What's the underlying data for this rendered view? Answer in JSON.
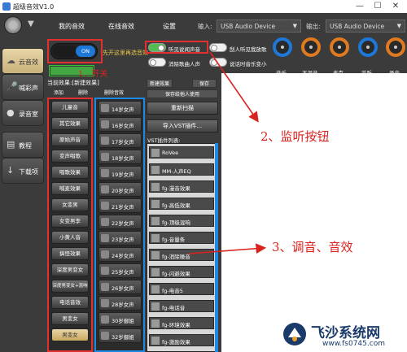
{
  "window": {
    "title": "超级音效V1.0",
    "min": "—",
    "max": "☐",
    "close": "✕"
  },
  "menu": {
    "tabs": [
      "我的音效",
      "在线音效",
      "设置"
    ]
  },
  "devices": {
    "input_label": "输入:",
    "input_value": "USB Audio Device",
    "output_label": "输出:",
    "output_value": "USB Audio Device"
  },
  "sidebar": {
    "items": [
      {
        "label": "云音效",
        "icon": "cloud-icon",
        "active": true
      },
      {
        "label": "喊彩声",
        "icon": "mic-icon"
      },
      {
        "label": "录音室",
        "icon": "record-icon"
      },
      {
        "label": "教程",
        "icon": "book-icon"
      },
      {
        "label": "下载项",
        "icon": "download-icon"
      }
    ]
  },
  "power": {
    "state": "ON",
    "hint": "先开这里再选音效"
  },
  "toggles": {
    "monitor": "听见说闻声音",
    "denoise": "消除歌曲人声",
    "opt1": "刮人听见我放歌",
    "opt2": "说话时音乐变小"
  },
  "knobs": [
    {
      "label": "音乐",
      "color": "#1e78d8"
    },
    {
      "label": "不混音",
      "color": "#e07a20"
    },
    {
      "label": "麦克",
      "color": "#e07a20"
    },
    {
      "label": "监听",
      "color": "#1e78d8"
    },
    {
      "label": "录音",
      "color": "#e07a20"
    }
  ],
  "list": {
    "header": "当前效果:[新建效果]",
    "buttons": [
      "添加",
      "删除",
      "删除音效"
    ],
    "right_buttons": [
      "新建效果",
      "保存",
      "保存给他人使用"
    ]
  },
  "effects": [
    "儿童音",
    "其它效果",
    "原始声音",
    "变声唱歌",
    "唱歌效果",
    "喊麦效果",
    "女变男",
    "女变男李",
    "小黄人音",
    "搞怪效果",
    "深度男变女",
    "深度男变女+混响",
    "电话音效",
    "男变女",
    "男变女"
  ],
  "voices": [
    "14岁女声",
    "16岁女声",
    "17岁女声",
    "18岁女声",
    "19岁女声",
    "20岁女声",
    "21岁女声",
    "22岁女声",
    "23岁女声",
    "24岁女声",
    "25岁女声",
    "26岁女声",
    "28岁女声",
    "30岁御姐",
    "32岁御姐"
  ],
  "right_panel": {
    "rescan": "重新扫描",
    "import_vst": "导入VST插件...",
    "vst_title": "VST插件列表:"
  },
  "vst": [
    "RoVee",
    "MM-人声EQ",
    "fg-漫音效果",
    "fg-高低效果",
    "fg-顶级混响",
    "fg-音量条",
    "fg-消除噪音",
    "fg-闪避效果",
    "fg-电音5",
    "fg-电话音",
    "fg-环境效果",
    "fg-激励效果"
  ],
  "annotations": {
    "a1": "1、开关",
    "a2": "2、监听按钮",
    "a3": "3、调音、音效"
  },
  "watermark": {
    "name": "飞沙系统网",
    "url": "www.fs0745.com"
  }
}
